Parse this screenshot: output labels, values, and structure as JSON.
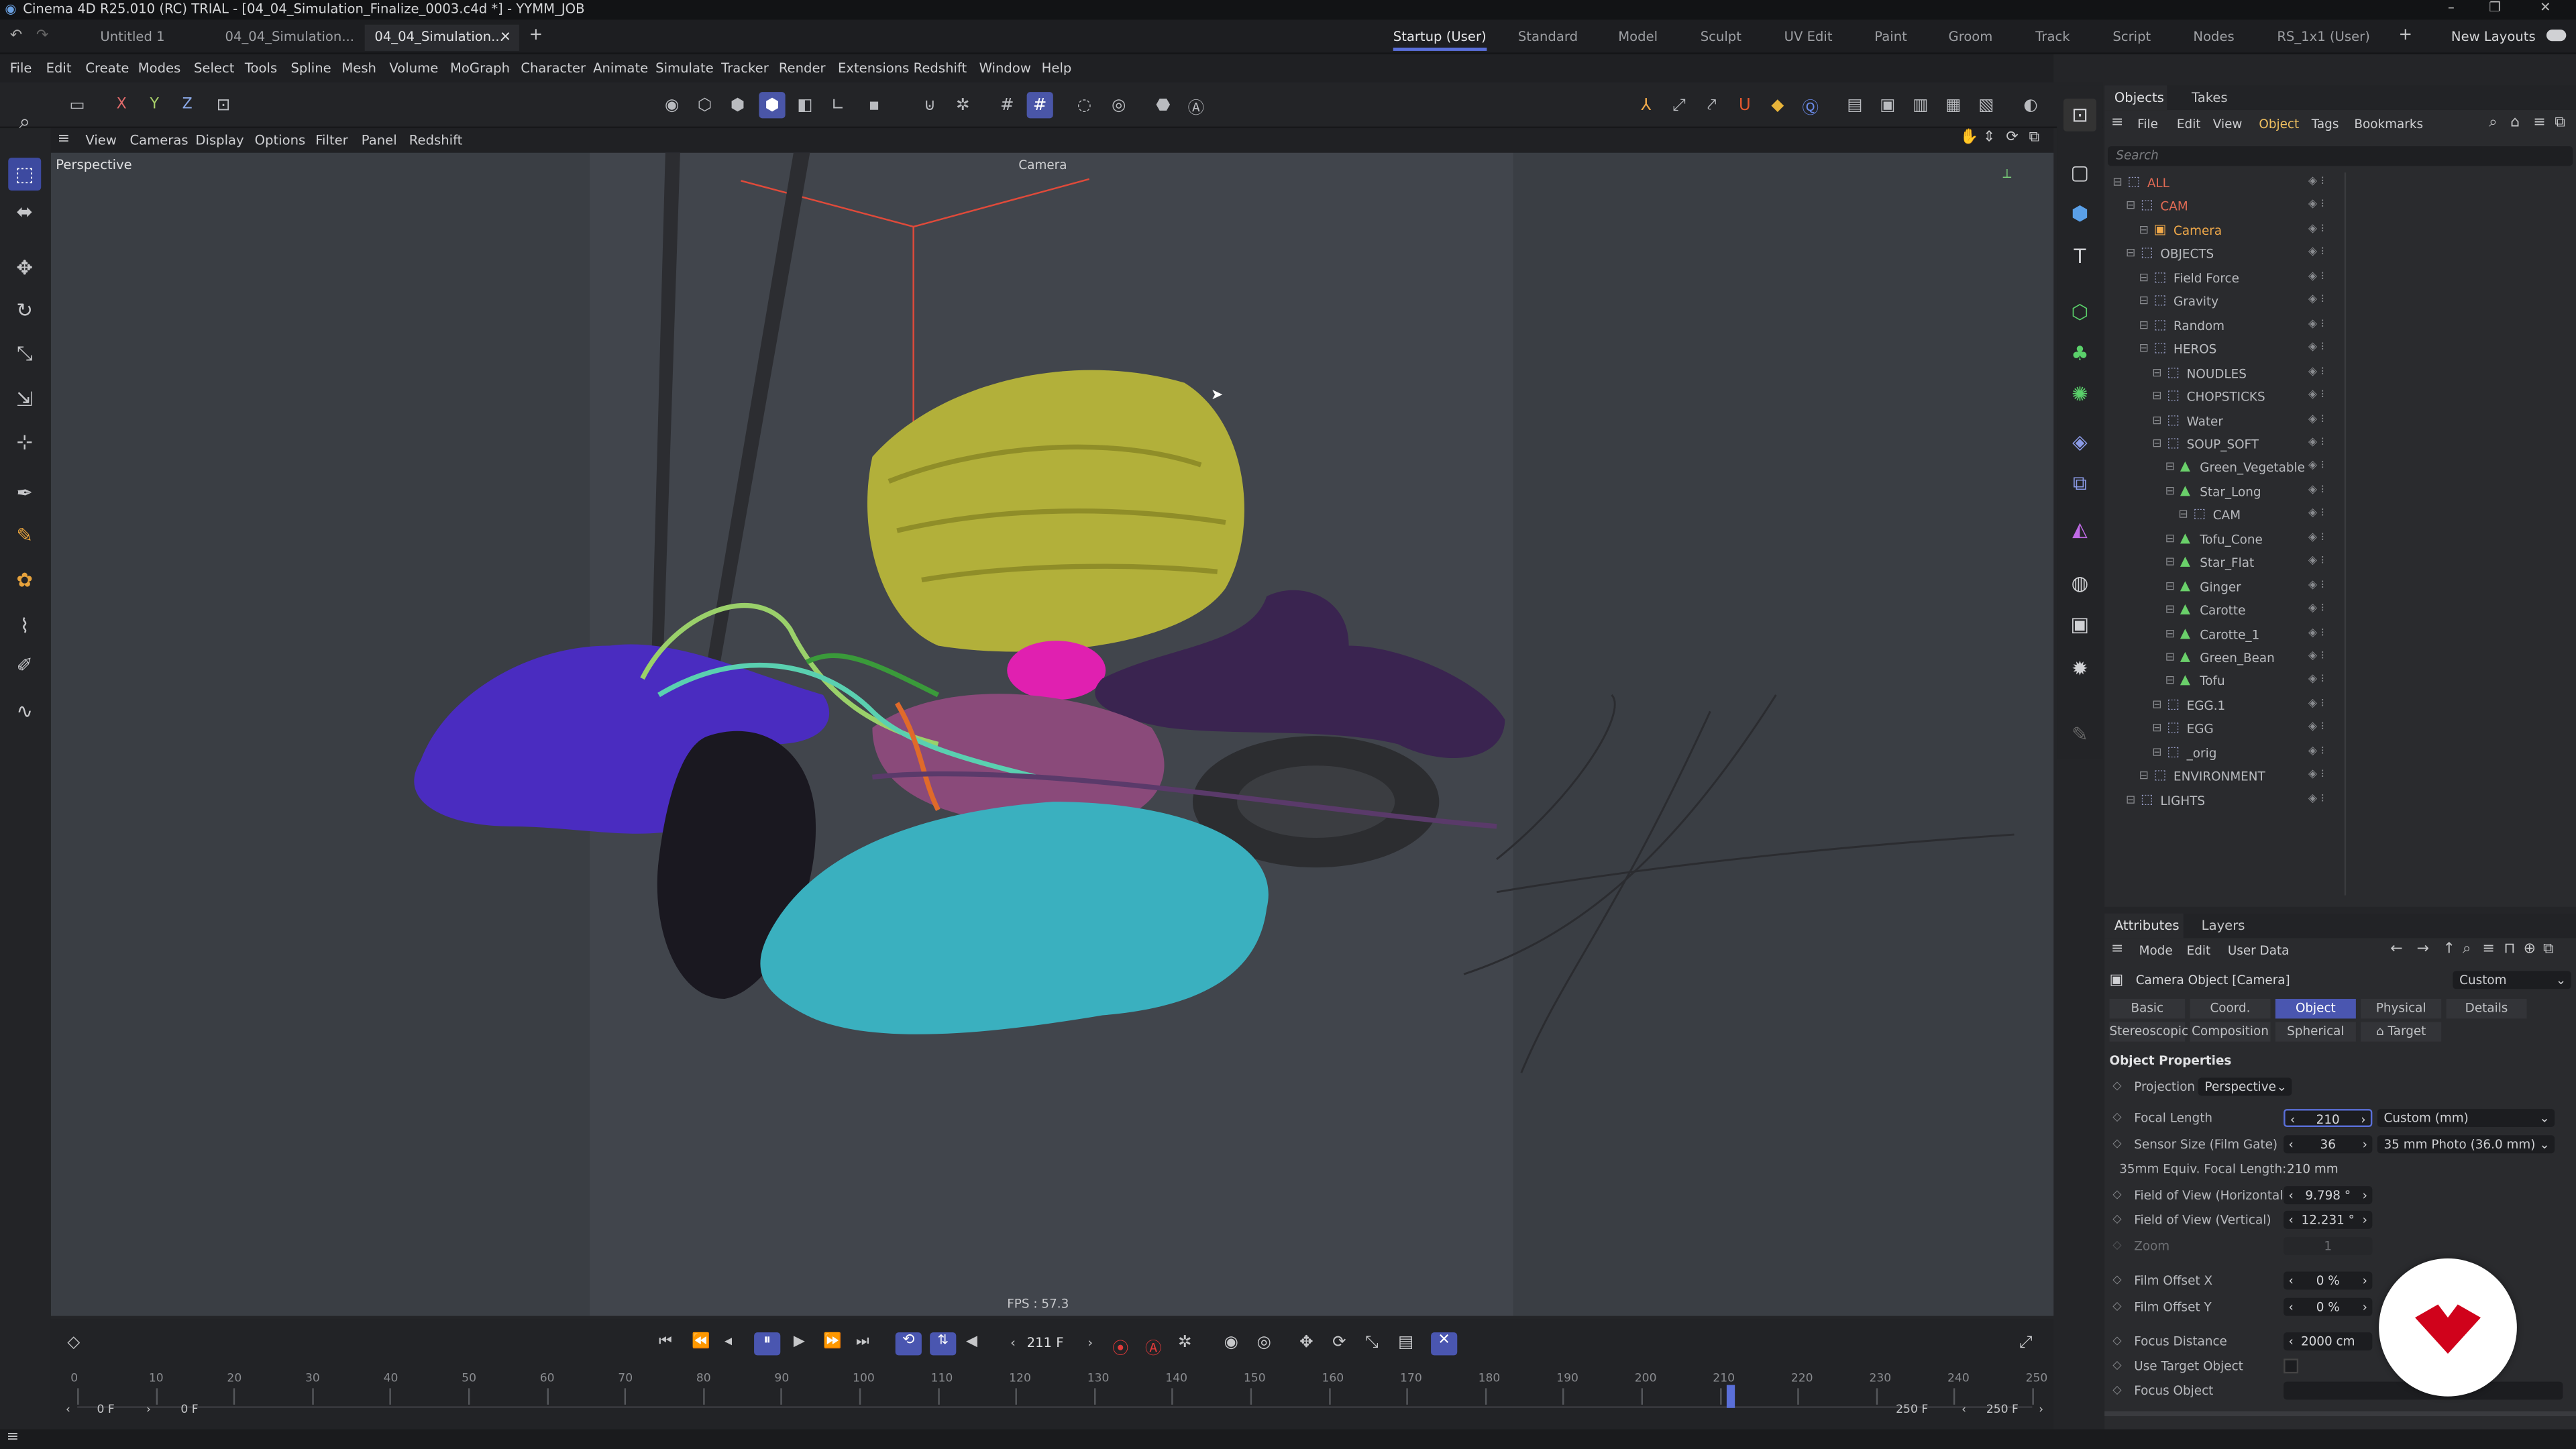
{
  "window": {
    "title": "Cinema 4D R25.010 (RC) TRIAL - [04_04_Simulation_Finalize_0003.c4d *] - YYMM_JOB",
    "minimize": "–",
    "maximize": "❐",
    "close": "✕"
  },
  "doc_tabs": [
    {
      "label": "Untitled 1"
    },
    {
      "label": "04_04_Simulation..."
    },
    {
      "label": "04_04_Simulation..."
    }
  ],
  "layouts": [
    "Startup (User)",
    "Standard",
    "Model",
    "Sculpt",
    "UV Edit",
    "Paint",
    "Groom",
    "Track",
    "Script",
    "Nodes",
    "RS_1x1 (User)"
  ],
  "new_layouts": "New Layouts",
  "menu": [
    "File",
    "Edit",
    "Create",
    "Modes",
    "Select",
    "Tools",
    "Spline",
    "Mesh",
    "Volume",
    "MoGraph",
    "Character",
    "Animate",
    "Simulate",
    "Tracker",
    "Render",
    "Extensions",
    "Redshift",
    "Window",
    "Help"
  ],
  "axis": {
    "x": "X",
    "y": "Y",
    "z": "Z"
  },
  "viewport_menu": [
    "View",
    "Cameras",
    "Display",
    "Options",
    "Filter",
    "Panel",
    "Redshift"
  ],
  "viewport": {
    "label": "Perspective",
    "camera_label": "Camera",
    "fps": "FPS : 57.3"
  },
  "timeline": {
    "current_frame": "211 F",
    "ticks": [
      "0",
      "10",
      "20",
      "30",
      "40",
      "50",
      "60",
      "70",
      "80",
      "90",
      "100",
      "110",
      "120",
      "130",
      "140",
      "150",
      "160",
      "170",
      "180",
      "190",
      "200",
      "210",
      "220",
      "230",
      "240",
      "250"
    ],
    "start_a": "0 F",
    "start_b": "0 F",
    "end_a": "250 F",
    "end_b": "250 F",
    "playhead": 211,
    "max": 250
  },
  "objects_panel": {
    "tabs": [
      "Objects",
      "Takes"
    ],
    "menu": [
      "File",
      "Edit",
      "View",
      "Object",
      "Tags",
      "Bookmarks"
    ],
    "search": "Search",
    "rows": [
      {
        "name": "ALL",
        "indent": 0,
        "color": "#e06a54",
        "icon": "layer-icon"
      },
      {
        "name": "CAM",
        "indent": 1,
        "color": "#e06a54",
        "icon": "null-icon"
      },
      {
        "name": "Camera",
        "indent": 2,
        "color": "#f0a94a",
        "icon": "camera-icon"
      },
      {
        "name": "OBJECTS",
        "indent": 1,
        "color": "#b9bbbf",
        "icon": "null-icon"
      },
      {
        "name": "Field Force",
        "indent": 2,
        "color": "#b9bbbf",
        "icon": "field-force-icon"
      },
      {
        "name": "Gravity",
        "indent": 2,
        "color": "#b9bbbf",
        "icon": "gravity-icon"
      },
      {
        "name": "Random",
        "indent": 2,
        "color": "#b9bbbf",
        "icon": "random-icon"
      },
      {
        "name": "HEROS",
        "indent": 2,
        "color": "#b9bbbf",
        "icon": "null-icon"
      },
      {
        "name": "NOUDLES",
        "indent": 3,
        "color": "#b9bbbf",
        "icon": "null-icon"
      },
      {
        "name": "CHOPSTICKS",
        "indent": 3,
        "color": "#b9bbbf",
        "icon": "null-icon"
      },
      {
        "name": "Water",
        "indent": 3,
        "color": "#b9bbbf",
        "icon": "water-icon"
      },
      {
        "name": "SOUP_SOFT",
        "indent": 3,
        "color": "#b9bbbf",
        "icon": "null-icon"
      },
      {
        "name": "Green_Vegetable",
        "indent": 4,
        "color": "#b9bbbf",
        "icon": "mesh-icon"
      },
      {
        "name": "Star_Long",
        "indent": 4,
        "color": "#b9bbbf",
        "icon": "mesh-icon"
      },
      {
        "name": "CAM",
        "indent": 5,
        "color": "#b9bbbf",
        "icon": "null-icon"
      },
      {
        "name": "Tofu_Cone",
        "indent": 4,
        "color": "#b9bbbf",
        "icon": "mesh-icon"
      },
      {
        "name": "Star_Flat",
        "indent": 4,
        "color": "#b9bbbf",
        "icon": "mesh-icon"
      },
      {
        "name": "Ginger",
        "indent": 4,
        "color": "#b9bbbf",
        "icon": "mesh-icon"
      },
      {
        "name": "Carotte",
        "indent": 4,
        "color": "#b9bbbf",
        "icon": "mesh-icon"
      },
      {
        "name": "Carotte_1",
        "indent": 4,
        "color": "#b9bbbf",
        "icon": "mesh-icon"
      },
      {
        "name": "Green_Bean",
        "indent": 4,
        "color": "#b9bbbf",
        "icon": "mesh-icon"
      },
      {
        "name": "Tofu",
        "indent": 4,
        "color": "#b9bbbf",
        "icon": "mesh-icon"
      },
      {
        "name": "EGG.1",
        "indent": 3,
        "color": "#b9bbbf",
        "icon": "null-icon"
      },
      {
        "name": "EGG",
        "indent": 3,
        "color": "#b9bbbf",
        "icon": "null-icon"
      },
      {
        "name": "_orig",
        "indent": 3,
        "color": "#b9bbbf",
        "icon": "null-icon"
      },
      {
        "name": "ENVIRONMENT",
        "indent": 2,
        "color": "#b9bbbf",
        "icon": "null-icon"
      },
      {
        "name": "LIGHTS",
        "indent": 1,
        "color": "#b9bbbf",
        "icon": "null-icon"
      }
    ]
  },
  "attributes": {
    "tabs": [
      "Attributes",
      "Layers"
    ],
    "menu": [
      "Mode",
      "Edit",
      "User Data"
    ],
    "object_title": "Camera Object [Camera]",
    "preset": "Custom",
    "prop_tabs_row1": [
      "Basic",
      "Coord.",
      "Object",
      "Physical",
      "Details"
    ],
    "prop_tabs_row2": [
      "Stereoscopic",
      "Composition",
      "Spherical",
      "Target"
    ],
    "section": "Object Properties",
    "projection_label": "Projection",
    "projection": "Perspective",
    "focal_length_label": "Focal Length",
    "focal_length": "210",
    "focal_preset": "Custom (mm)",
    "sensor_label": "Sensor Size (Film Gate)",
    "sensor": "36",
    "sensor_preset": "35 mm Photo (36.0 mm)",
    "equiv_label": "35mm Equiv. Focal Length:",
    "equiv": "210 mm",
    "fovh_label": "Field of View (Horizontal)",
    "fovh": "9.798 °",
    "fovv_label": "Field of View (Vertical)",
    "fovv": "12.231 °",
    "zoom_label": "Zoom",
    "zoom": "1",
    "offx_label": "Film Offset X",
    "offx": "0 %",
    "offy_label": "Film Offset Y",
    "offy": "0 %",
    "focus_label": "Focus Distance",
    "focus": "2000 cm",
    "target_label": "Use Target Object",
    "focus_obj_label": "Focus Object"
  },
  "colors": {
    "accent": "#4a56b0",
    "logo_red": "#d0021b"
  }
}
